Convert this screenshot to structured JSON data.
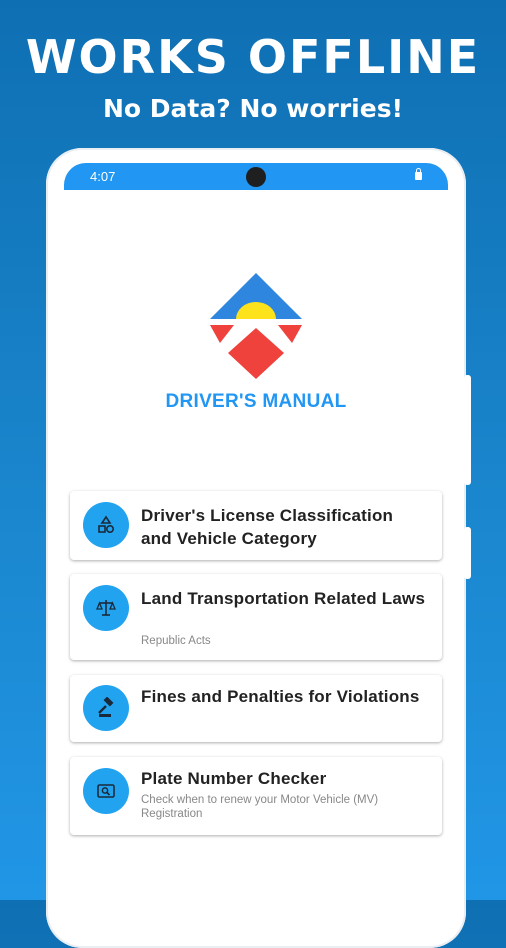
{
  "promo": {
    "headline": "WORKS OFFLINE",
    "subheadline": "No Data? No worries!"
  },
  "status_bar": {
    "time": "4:07"
  },
  "app": {
    "name": "DRIVER'S MANUAL"
  },
  "menu": {
    "items": [
      {
        "title": "Driver's License Classification and Vehicle Category",
        "subtitle": "",
        "icon": "shapes-icon"
      },
      {
        "title": "Land Transportation Related Laws",
        "subtitle": "Republic Acts",
        "icon": "scale-icon"
      },
      {
        "title": "Fines and Penalties for Violations",
        "subtitle": "",
        "icon": "gavel-icon"
      },
      {
        "title": "Plate Number Checker",
        "subtitle": "Check when to renew your Motor Vehicle (MV) Registration",
        "icon": "plate-search-icon"
      }
    ]
  },
  "colors": {
    "accent": "#2196f3",
    "icon_circle": "#21a3f0",
    "logo_blue": "#2f86de",
    "logo_yellow": "#fde21c",
    "logo_red": "#f0423c"
  }
}
